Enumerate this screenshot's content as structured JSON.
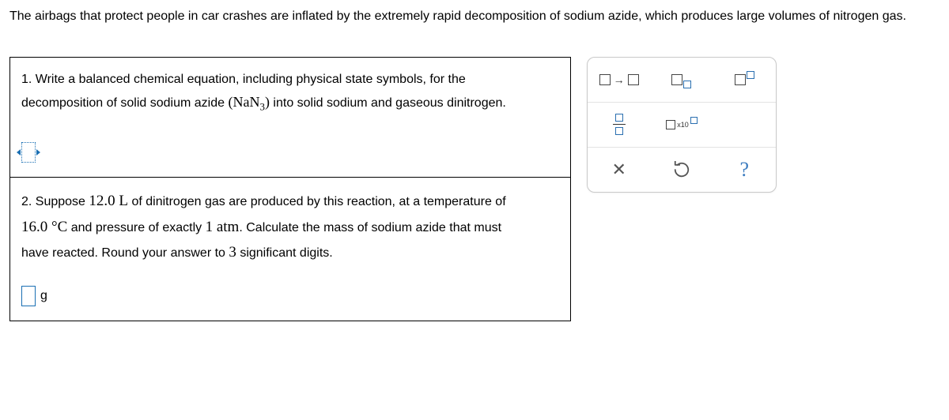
{
  "intro": "The airbags that protect people in car crashes are inflated by the extremely rapid decomposition of sodium azide, which produces large volumes of nitrogen gas.",
  "q1": {
    "line1": "1. Write a balanced chemical equation, including physical state symbols, for the",
    "line2_a": "decomposition of solid sodium azide ",
    "formula_open": "(",
    "formula_base": "NaN",
    "formula_sub": "3",
    "formula_close": ")",
    "line2_b": " into solid sodium and gaseous dinitrogen."
  },
  "q2": {
    "t1": "2. Suppose ",
    "vol": "12.0 L",
    "t2": " of dinitrogen gas are produced by this reaction, at a temperature of",
    "temp": "16.0 °C",
    "t3": " and pressure of exactly ",
    "press": "1 atm",
    "t4": ". Calculate the mass of sodium azide that must",
    "t5": "have reacted. Round your answer to ",
    "sig": "3",
    "t6": " significant digits.",
    "unit": "g"
  },
  "tools": {
    "x10_label": "x10",
    "clear_glyph": "✕",
    "help_glyph": "?"
  }
}
